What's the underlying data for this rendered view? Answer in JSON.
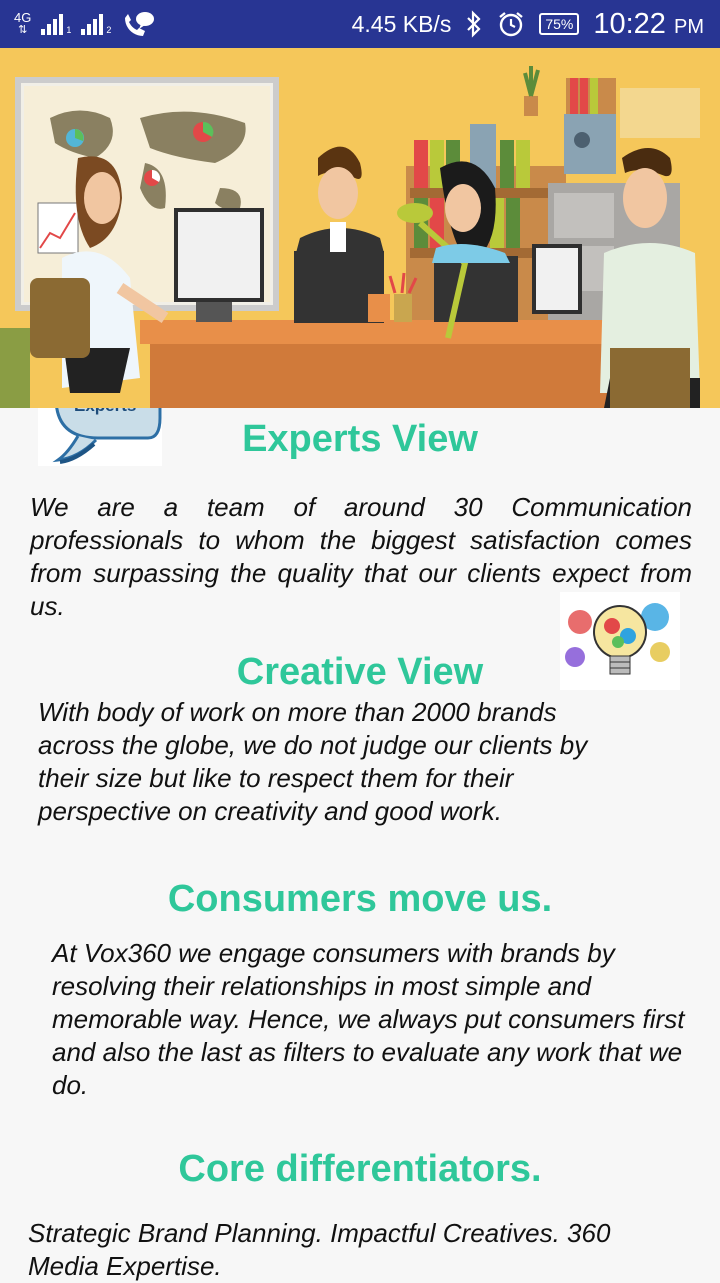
{
  "status_bar": {
    "network": "4G",
    "sim1": "1",
    "sim2": "2",
    "speed": "4.45 KB/s",
    "battery": "75%",
    "time": "10:22",
    "ampm": "PM"
  },
  "banner": {
    "icon": "office-illustration"
  },
  "experts_thumbnail_text": "Experts",
  "sections": {
    "experts": {
      "title": "Experts View",
      "body": "We are a team of around 30 Communication professionals to whom the biggest satisfaction comes from surpassing the quality that our clients expect from us."
    },
    "creative": {
      "title": "Creative View",
      "body": "With body of work on more than 2000 brands across the globe, we do not judge our clients by their size but like to respect them for their perspective on creativity and good work."
    },
    "consumers": {
      "title": "Consumers move us.",
      "body": "At Vox360 we engage consumers with brands by resolving their relationships in most simple and memorable way. Hence, we always put consumers first and also the last as filters to evaluate any work that we do."
    },
    "core": {
      "title": "Core differentiators.",
      "body": "Strategic Brand Planning. Impactful Creatives. 360 Media Expertise."
    }
  },
  "colors": {
    "status_bar": "#283593",
    "heading": "#2fc79a",
    "banner_bg": "#f5c75a"
  }
}
